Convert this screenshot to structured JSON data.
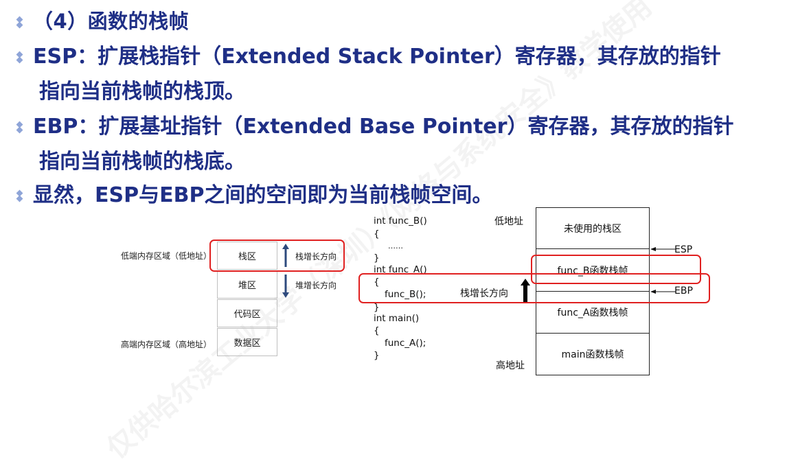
{
  "heading": "（4）函数的栈帧",
  "bullets": [
    {
      "line1": "ESP：扩展栈指针（Extended Stack Pointer）寄存器，其存放的指针",
      "line2": "指向当前栈帧的栈顶。"
    },
    {
      "line1": "EBP：扩展基址指针（Extended Base Pointer）寄存器，其存放的指针",
      "line2": "指向当前栈帧的栈底。"
    },
    {
      "line1": "显然，ESP与EBP之间的空间即为当前栈帧空间。"
    }
  ],
  "memory_diagram": {
    "low_label": "低端内存区域（低地址）",
    "high_label": "高端内存区域（高地址）",
    "regions": [
      "栈区",
      "堆区",
      "代码区",
      "数据区"
    ],
    "stack_growth": "栈增长方向",
    "heap_growth": "堆增长方向"
  },
  "code": {
    "lines": [
      "int func_B()",
      "{",
      "……",
      "}",
      "int func_A()",
      "{",
      "func_B();",
      "}",
      "int main()",
      "{",
      "func_A();",
      "}"
    ]
  },
  "stack_diagram": {
    "low_addr": "低地址",
    "high_addr": "高地址",
    "frames": [
      "未使用的栈区",
      "func_B函数栈帧",
      "func_A函数栈帧",
      "main函数栈帧"
    ],
    "esp": "ESP",
    "ebp": "EBP",
    "growth": "栈增长方向"
  },
  "watermark": "仅供哈尔滨工业大学（深圳）《网络与系统安全》教学使用"
}
